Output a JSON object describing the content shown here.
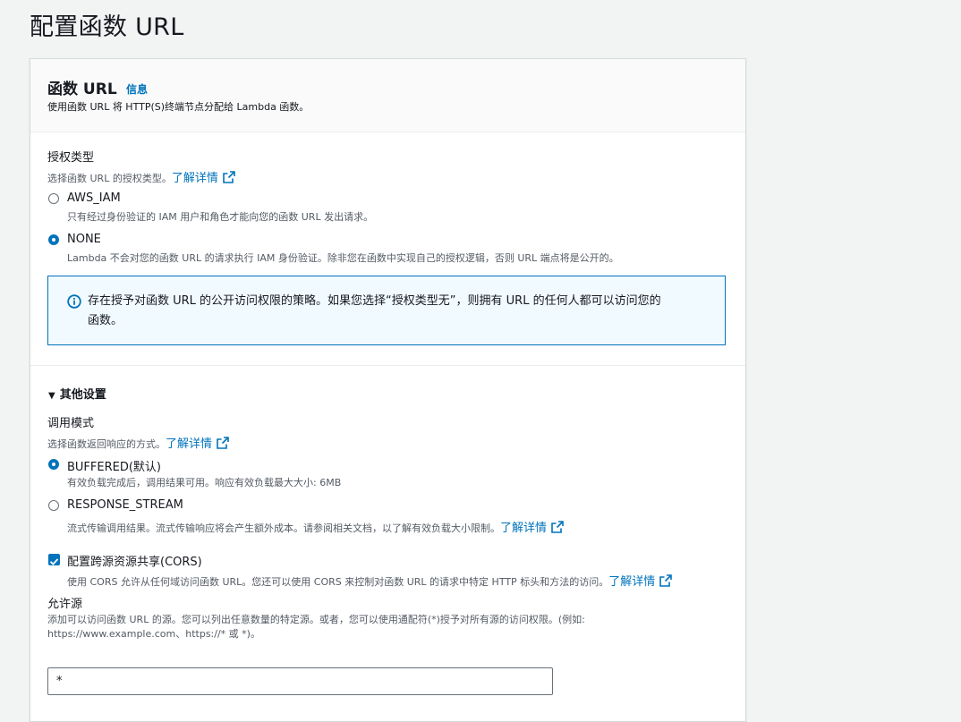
{
  "page": {
    "title": "配置函数 URL"
  },
  "header": {
    "title": "函数 URL",
    "info": "信息",
    "description": "使用函数 URL 将 HTTP(S)终端节点分配给 Lambda 函数。"
  },
  "auth": {
    "label": "授权类型",
    "description": "选择函数 URL 的授权类型。",
    "learn_more": "了解详情",
    "options": [
      {
        "label": "AWS_IAM",
        "description": "只有经过身份验证的 IAM 用户和角色才能向您的函数 URL 发出请求。",
        "selected": false
      },
      {
        "label": "NONE",
        "description": "Lambda 不会对您的函数 URL 的请求执行 IAM 身份验证。除非您在函数中实现自己的授权逻辑，否则 URL 端点将是公开的。",
        "selected": true
      }
    ],
    "alert_line1": "存在授予对函数 URL 的公开访问权限的策略。如果您选择“授权类型无”，则拥有 URL 的任何人都可以访问您的",
    "alert_line2": "函数。"
  },
  "additional": {
    "toggle_label": "其他设置",
    "invoke_mode": {
      "label": "调用模式",
      "description": "选择函数返回响应的方式。",
      "learn_more": "了解详情",
      "options": [
        {
          "label": "BUFFERED(默认)",
          "description": "有效负载完成后，调用结果可用。响应有效负载最大大小: 6MB",
          "selected": true
        },
        {
          "label": "RESPONSE_STREAM",
          "description": "流式传输调用结果。流式传输响应将会产生额外成本。请参阅相关文档，以了解有效负载大小限制。",
          "learn_more": "了解详情",
          "selected": false
        }
      ]
    },
    "cors": {
      "label": "配置跨源资源共享(CORS)",
      "checked": true,
      "description": "使用 CORS 允许从任何域访问函数 URL。您还可以使用 CORS 来控制对函数 URL 的请求中特定 HTTP 标头和方法的访问。",
      "learn_more": "了解详情"
    },
    "allow_origin": {
      "label": "允许源",
      "description_line1": "添加可以访问函数 URL 的源。您可以列出任意数量的特定源。或者，您可以使用通配符(*)授予对所有源的访问权限。(例如:",
      "description_line2": "https://www.example.com、https://* 或 *)。",
      "value": "*"
    }
  },
  "colors": {
    "accent": "#0073bb",
    "alert_bg": "#f1faff",
    "page_bg": "#f2f3f3"
  }
}
